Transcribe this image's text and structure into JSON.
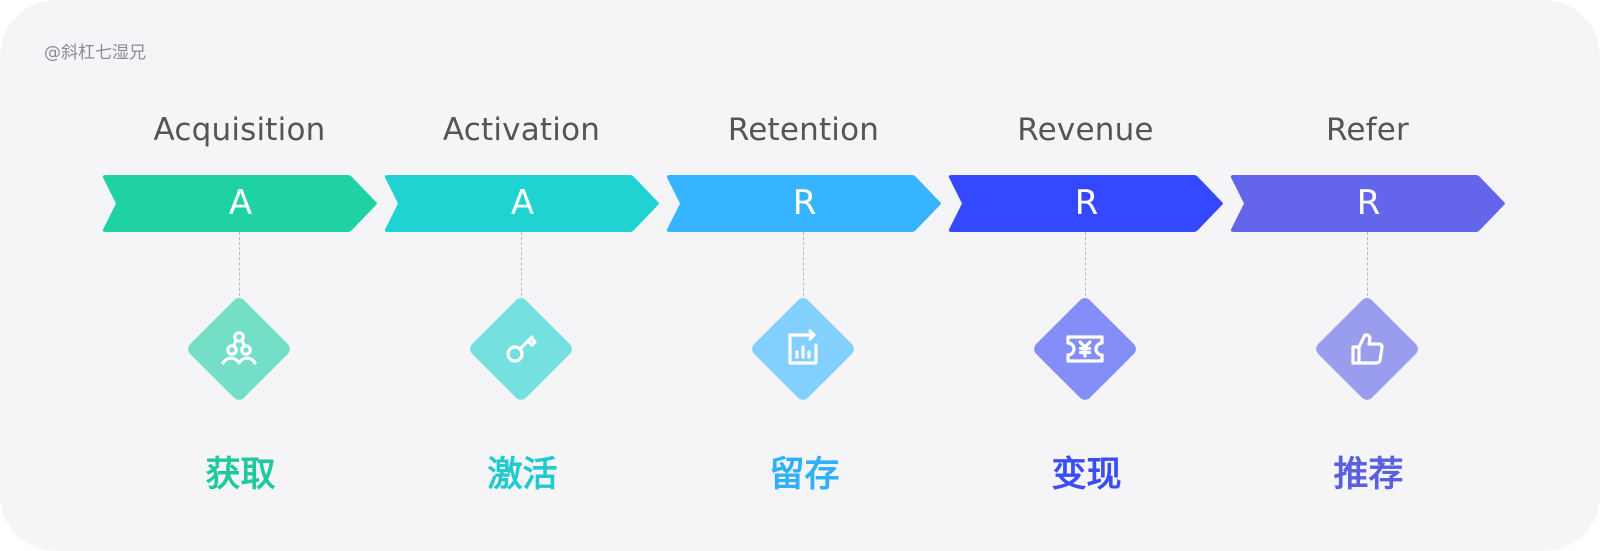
{
  "watermark": "@斜杠七湿兄",
  "stages": [
    {
      "title": "Acquisition",
      "letter": "A",
      "label": "获取",
      "icon": "users-group-icon",
      "color": "#1ed2a3",
      "diamond_color": "#72dfc6",
      "label_color": "#1fc99b"
    },
    {
      "title": "Activation",
      "letter": "A",
      "label": "激活",
      "icon": "key-icon",
      "color": "#20d3d3",
      "diamond_color": "#74e0e0",
      "label_color": "#22c9cf"
    },
    {
      "title": "Retention",
      "letter": "R",
      "label": "留存",
      "icon": "chart-report-icon",
      "color": "#36b4ff",
      "diamond_color": "#83cffd",
      "label_color": "#2fb0fb"
    },
    {
      "title": "Revenue",
      "letter": "R",
      "label": "变现",
      "icon": "yuan-ticket-icon",
      "color": "#3448ff",
      "diamond_color": "#848ef8",
      "label_color": "#3a4ef5"
    },
    {
      "title": "Refer",
      "letter": "R",
      "label": "推荐",
      "icon": "thumbs-up-icon",
      "color": "#6366ea",
      "diamond_color": "#9a9cee",
      "label_color": "#5a5fe0"
    }
  ]
}
